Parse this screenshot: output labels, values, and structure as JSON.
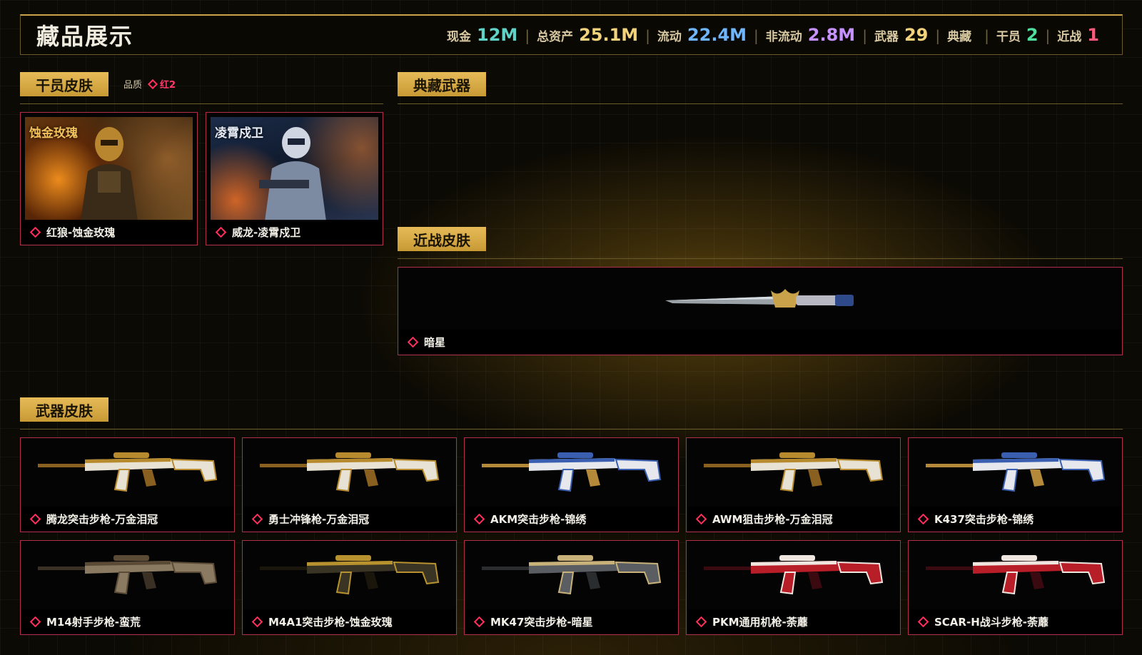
{
  "header": {
    "title": "藏品展示",
    "stats": [
      {
        "label": "现金",
        "value": "12M",
        "color": "#5fd3c8"
      },
      {
        "label": "总资产",
        "value": "25.1M",
        "color": "#f2d27a"
      },
      {
        "label": "流动",
        "value": "22.4M",
        "color": "#6fb6ff"
      },
      {
        "label": "非流动",
        "value": "2.8M",
        "color": "#c592ff"
      },
      {
        "label": "武器",
        "value": "29",
        "color": "#f2d27a"
      },
      {
        "label": "典藏",
        "value": "",
        "color": "#f2d27a"
      },
      {
        "label": "干员",
        "value": "2",
        "color": "#4fe0a0"
      },
      {
        "label": "近战",
        "value": "1",
        "color": "#ff5a7a"
      }
    ]
  },
  "sections": {
    "operator": {
      "title": "干员皮肤",
      "quality_label": "品质",
      "quality_value": "红2"
    },
    "collection": {
      "title": "典藏武器"
    },
    "melee": {
      "title": "近战皮肤"
    },
    "weapons": {
      "title": "武器皮肤"
    }
  },
  "operators": [
    {
      "name": "红狼-蚀金玫瑰",
      "banner": "蚀金玫瑰"
    },
    {
      "name": "威龙-凌霄戍卫",
      "banner": "凌霄戍卫"
    }
  ],
  "melee": [
    {
      "name": "暗星"
    }
  ],
  "weapons": [
    {
      "name": "腾龙突击步枪-万金泪冠",
      "theme": "gold"
    },
    {
      "name": "勇士冲锋枪-万金泪冠",
      "theme": "gold"
    },
    {
      "name": "AKM突击步枪-锦绣",
      "theme": "blue"
    },
    {
      "name": "AWM狙击步枪-万金泪冠",
      "theme": "gold"
    },
    {
      "name": "K437突击步枪-锦绣",
      "theme": "blue"
    },
    {
      "name": "M14射手步枪-蛮荒",
      "theme": "brown"
    },
    {
      "name": "M4A1突击步枪-蚀金玫瑰",
      "theme": "dark"
    },
    {
      "name": "MK47突击步枪-暗星",
      "theme": "silver"
    },
    {
      "name": "PKM通用机枪-荼蘼",
      "theme": "red"
    },
    {
      "name": "SCAR-H战斗步枪-荼蘼",
      "theme": "red"
    }
  ],
  "colors": {
    "accent_gold": "#e6bb58",
    "card_border": "#b0304a",
    "rarity_red": "#ff2f5c"
  }
}
